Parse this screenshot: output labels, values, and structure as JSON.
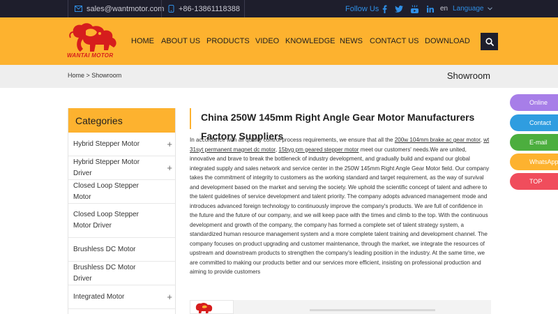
{
  "topbar": {
    "email": "sales@wantmotor.com",
    "phone": "+86-13861118388",
    "follow_label": "Follow Us",
    "lang_code": "en",
    "language_label": "Language"
  },
  "brand": {
    "logo_text": "WANTAI MOTOR"
  },
  "nav": {
    "items": [
      {
        "label": "HOME"
      },
      {
        "label": "ABOUT US"
      },
      {
        "label": "PRODUCTS"
      },
      {
        "label": "VIDEO"
      },
      {
        "label": "KNOWLEDGE"
      },
      {
        "label": "NEWS"
      },
      {
        "label": "CONTACT US"
      },
      {
        "label": "DOWNLOAD"
      }
    ]
  },
  "breadcrumb": {
    "text": "Home > Showroom",
    "title": "Showroom"
  },
  "sidebar": {
    "title": "Categories",
    "items": [
      {
        "label": "Hybrid Stepper Motor"
      },
      {
        "label": "Hybrid Stepper Motor Driver"
      },
      {
        "label": "Closed Loop Stepper Motor"
      },
      {
        "label": "Closed Loop Stepper Motor Driver"
      },
      {
        "label": "Brushless DC Motor"
      },
      {
        "label": "Brushless DC Motor Driver"
      },
      {
        "label": "Integrated Motor"
      }
    ]
  },
  "content": {
    "title": "China 250W 145mm Right Angle Gear Motor Manufacturers Factory Suppliers",
    "intro": "In accordance with all quality control process requirements, we ensure that all the ",
    "link1": "200w 104mm brake ac gear motor",
    "sep1": ", ",
    "link2": "wt 31syt permanent magnet dc motor",
    "sep2": ", ",
    "link3": "15byg pm geared stepper motor",
    "body": " meet our customers' needs.We are united, innovative and brave to break the bottleneck of industry development, and gradually build and expand our global integrated supply and sales network and service center in the 250W 145mm Right Angle Gear Motor field. Our company takes the commitment of integrity to customers as the working standard and target requirement, as the way of survival and development based on the market and serving the society. We uphold the scientific concept of talent and adhere to the talent guidelines of service development and talent priority. The company adopts advanced management mode and introduces advanced foreign technology to continuously improve the company's products. We are full of confidence in the future and the future of our company, and we will keep pace with the times and climb to the top. With the continuous development and growth of the company, the company has formed a complete set of talent strategy system, a standardized human resource management system and a more complete talent training and development channel. The company focuses on product upgrading and customer maintenance, through the market, we integrate the resources of upstream and downstream products to strengthen the company's leading position in the industry. At the same time, we are committed to making our products better and our services more efficient, insisting on professional production and aiming to provide customers"
  },
  "floating": [
    {
      "label": "Online",
      "color": "#a77ee8"
    },
    {
      "label": "Contact",
      "color": "#2f9de0"
    },
    {
      "label": "E-mail",
      "color": "#4cae3e"
    },
    {
      "label": "WhatsApp",
      "color": "#fdb22f"
    },
    {
      "label": "TOP",
      "color": "#f04d5c"
    }
  ]
}
